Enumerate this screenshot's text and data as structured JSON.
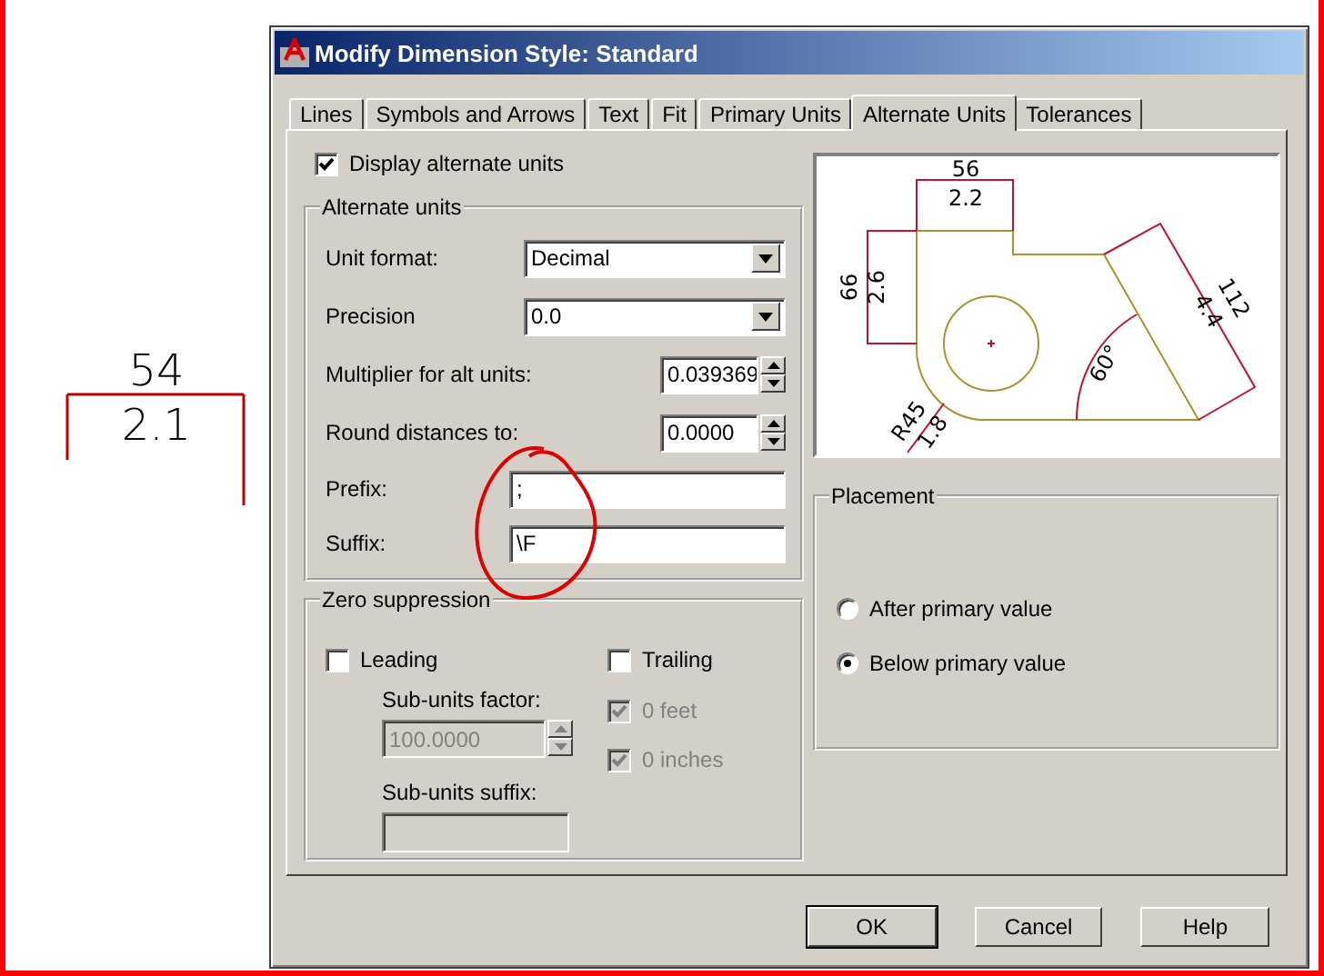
{
  "sample_dimension": {
    "primary": "54",
    "alternate": "2.1"
  },
  "window": {
    "title": "Modify Dimension Style: Standard"
  },
  "tabs": [
    {
      "label": "Lines",
      "selected": false
    },
    {
      "label": "Symbols and Arrows",
      "selected": false
    },
    {
      "label": "Text",
      "selected": false
    },
    {
      "label": "Fit",
      "selected": false
    },
    {
      "label": "Primary Units",
      "selected": false
    },
    {
      "label": "Alternate Units",
      "selected": true
    },
    {
      "label": "Tolerances",
      "selected": false
    }
  ],
  "display_alternate_units": {
    "label": "Display alternate units",
    "checked": true
  },
  "alternate_units": {
    "title": "Alternate units",
    "rows": [
      {
        "kind": "dropdown",
        "label": "Unit format:",
        "value": "Decimal"
      },
      {
        "kind": "dropdown",
        "label": "Precision",
        "value": "0.0"
      },
      {
        "kind": "spinner",
        "label": "Multiplier for alt units:",
        "value": "0.039369"
      },
      {
        "kind": "spinner",
        "label": "Round distances to:",
        "value": "0.0000"
      },
      {
        "kind": "text",
        "label": "Prefix:",
        "value": ";"
      },
      {
        "kind": "text",
        "label": "Suffix:",
        "value": "\\F"
      }
    ]
  },
  "zero_suppression": {
    "title": "Zero suppression",
    "leading": {
      "label": "Leading",
      "checked": false
    },
    "trailing": {
      "label": "Trailing",
      "checked": false
    },
    "sub_units_factor": {
      "label": "Sub-units factor:",
      "value": "100.0000",
      "disabled": true
    },
    "feet": {
      "label": "0 feet",
      "checked": true,
      "disabled": true
    },
    "inches": {
      "label": "0 inches",
      "checked": true,
      "disabled": true
    },
    "sub_units_suffix": {
      "label": "Sub-units suffix:",
      "disabled": true
    }
  },
  "preview": {
    "labels": [
      "56",
      "2.2",
      "66",
      "2.6",
      "112",
      "4.4",
      "60°",
      "R45",
      "1.8"
    ]
  },
  "placement": {
    "title": "Placement",
    "options": [
      {
        "label": "After primary value",
        "selected": false
      },
      {
        "label": "Below primary value",
        "selected": true
      }
    ]
  },
  "buttons": [
    "OK",
    "Cancel",
    "Help"
  ]
}
